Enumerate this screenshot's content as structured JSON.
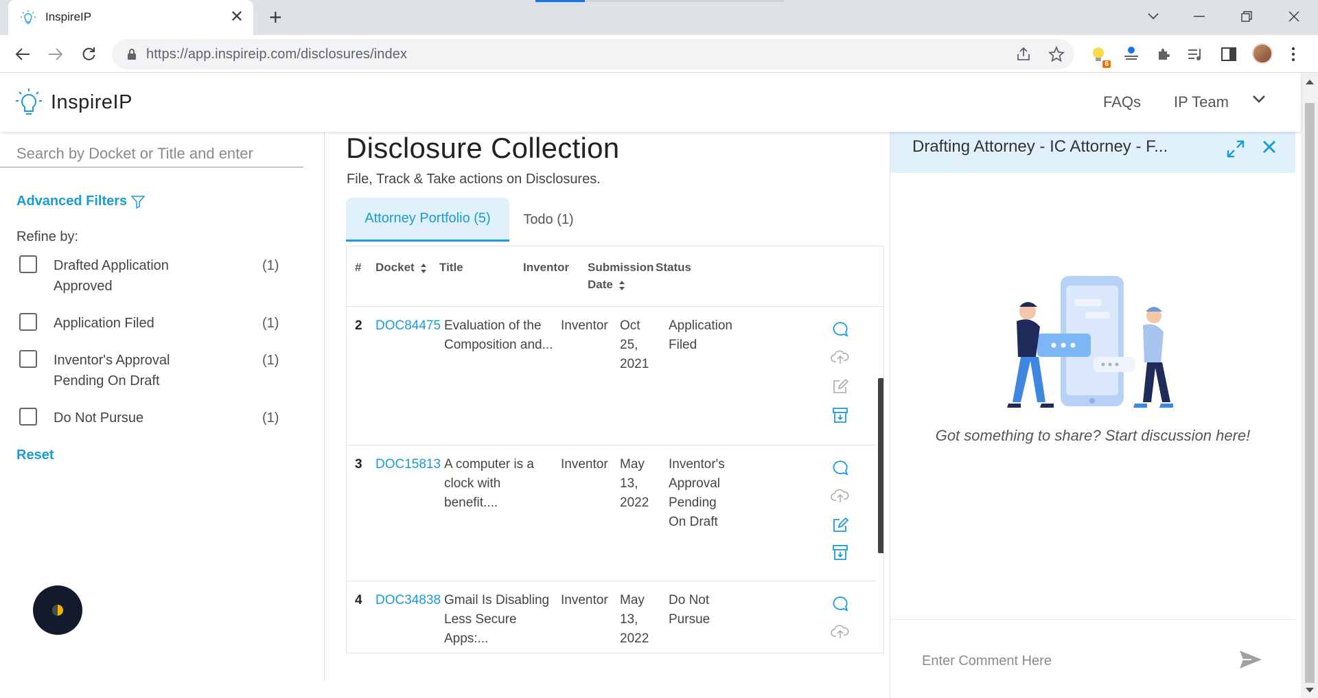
{
  "browser": {
    "tab_title": "InspireIP",
    "url_host": "https://app.inspireip.com",
    "url_path": "/disclosures/index",
    "extension_badge": "6"
  },
  "header": {
    "brand": "InspireIP",
    "faqs": "FAQs",
    "team": "IP Team"
  },
  "filters": {
    "search_placeholder": "Search by Docket or Title and enter",
    "advanced": "Advanced Filters",
    "refine": "Refine by:",
    "items": [
      {
        "label": "Drafted Application Approved",
        "count": "(1)"
      },
      {
        "label": "Application Filed",
        "count": "(1)"
      },
      {
        "label": "Inventor's Approval Pending On Draft",
        "count": "(1)"
      },
      {
        "label": "Do Not Pursue",
        "count": "(1)"
      }
    ],
    "reset": "Reset"
  },
  "main": {
    "title": "Disclosure Collection",
    "subtitle": "File, Track & Take actions on Disclosures.",
    "tabs": [
      {
        "label": "Attorney Portfolio (5)",
        "active": true
      },
      {
        "label": "Todo (1)",
        "active": false
      }
    ],
    "columns": {
      "num": "#",
      "docket": "Docket",
      "title": "Title",
      "inventor": "Inventor",
      "submission_date": "Submission Date",
      "status": "Status"
    },
    "rows": [
      {
        "num": "2",
        "docket": "DOC84475",
        "title": "Evaluation of the Composition and...",
        "inventor": "Inventor",
        "date": "Oct 25, 2021",
        "status": "Application Filed"
      },
      {
        "num": "3",
        "docket": "DOC15813",
        "title": "A computer is a clock with benefit....",
        "inventor": "Inventor",
        "date": "May 13, 2022",
        "status": "Inventor's Approval Pending On Draft"
      },
      {
        "num": "4",
        "docket": "DOC34838",
        "title": "Gmail Is Disabling Less Secure Apps:...",
        "inventor": "Inventor",
        "date": "May 13, 2022",
        "status": "Do Not Pursue"
      }
    ]
  },
  "chat": {
    "title": "Drafting Attorney - IC Attorney - F...",
    "empty_message": "Got something to share? Start discussion here!",
    "comment_placeholder": "Enter Comment Here"
  },
  "colors": {
    "accent": "#1a9bd7",
    "tab_bg": "#e1f1fb",
    "fab": "#131a2e"
  }
}
